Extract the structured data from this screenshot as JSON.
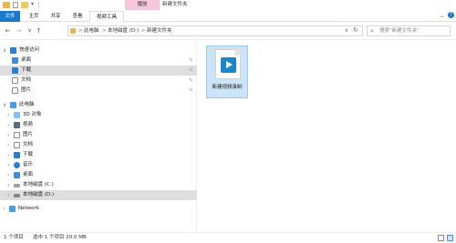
{
  "titlebar": {
    "tool_tab": "播放",
    "window_title": "新建文件夹"
  },
  "ribbon": {
    "tabs": [
      "文件",
      "主页",
      "共享",
      "查看",
      "视频工具"
    ]
  },
  "address": {
    "breadcrumbs": [
      "此电脑",
      "本地磁盘 (D:)",
      "新建文件夹"
    ],
    "separator": ">",
    "search_placeholder": "搜索\"新建文件夹\""
  },
  "sidebar": {
    "items": [
      {
        "label": "快速访问",
        "icon": "star-icon",
        "pinned": false
      },
      {
        "label": "桌面",
        "icon": "desktop-icon",
        "pinned": true
      },
      {
        "label": "下载",
        "icon": "download-icon",
        "pinned": true
      },
      {
        "label": "文档",
        "icon": "documents-icon",
        "pinned": true
      },
      {
        "label": "图片",
        "icon": "pictures-icon",
        "pinned": true
      },
      {
        "label": "此电脑",
        "icon": "computer-icon",
        "pinned": false
      },
      {
        "label": "3D 对象",
        "icon": "3d-objects-icon",
        "pinned": false
      },
      {
        "label": "视频",
        "icon": "videos-icon",
        "pinned": false
      },
      {
        "label": "图片",
        "icon": "pictures-icon",
        "pinned": false
      },
      {
        "label": "文档",
        "icon": "documents-icon",
        "pinned": false
      },
      {
        "label": "下载",
        "icon": "download-icon",
        "pinned": false
      },
      {
        "label": "音乐",
        "icon": "music-icon",
        "pinned": false
      },
      {
        "label": "桌面",
        "icon": "desktop-icon",
        "pinned": false
      },
      {
        "label": "本地磁盘 (C:)",
        "icon": "drive-icon",
        "pinned": false
      },
      {
        "label": "本地磁盘 (D:)",
        "icon": "drive-icon",
        "pinned": false
      },
      {
        "label": "Network",
        "icon": "network-icon",
        "pinned": false
      }
    ],
    "pin_glyph": "✎"
  },
  "content": {
    "file_name": "新建视频录制"
  },
  "status": {
    "item_count": "1 个项目",
    "selection": "选中 1 个项目  20.0 MB"
  },
  "colors": {
    "accent": "#1979ca",
    "tool_tab": "#f7c6dc",
    "selection": "#cce4f7"
  }
}
